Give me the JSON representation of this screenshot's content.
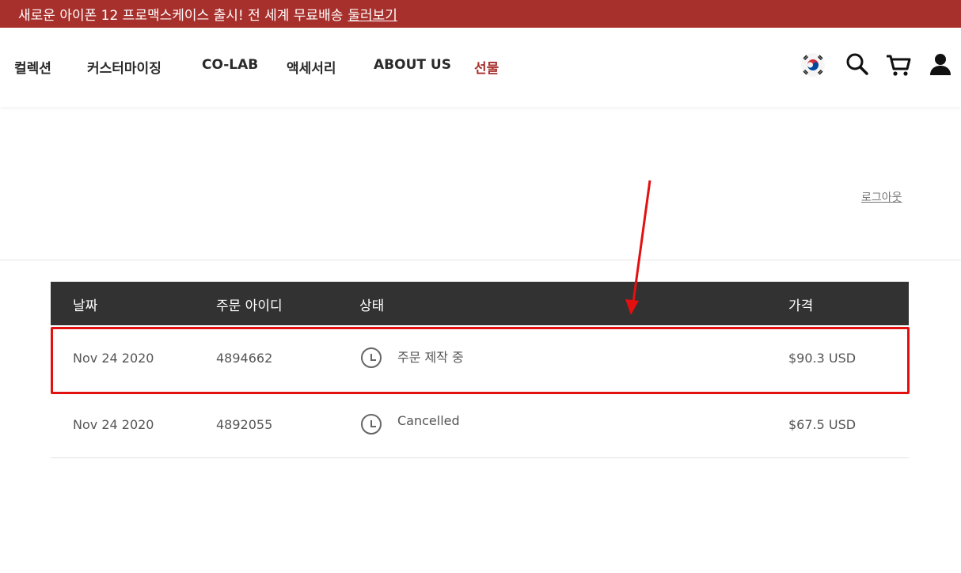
{
  "promo": {
    "text": "새로운 아이폰 12 프로맥스케이스 출시! 전 세계 무료배송",
    "link": "둘러보기"
  },
  "nav": {
    "items": [
      "컬렉션",
      "커스터마이징",
      "CO-LAB",
      "액세서리",
      "ABOUT US",
      "선물"
    ],
    "active_index": 5,
    "icons": [
      "korea-flag-icon",
      "search-icon",
      "cart-icon",
      "user-icon"
    ]
  },
  "account": {
    "logout": "로그아웃"
  },
  "orders": {
    "headers": {
      "date": "날짜",
      "order_id": "주문 아이디",
      "status": "상태",
      "price": "가격"
    },
    "rows": [
      {
        "date": "Nov 24 2020",
        "order_id": "4894662",
        "status": "주문 제작 중",
        "price": "$90.3 USD"
      },
      {
        "date": "Nov 24 2020",
        "order_id": "4892055",
        "status": "Cancelled",
        "price": "$67.5 USD"
      }
    ]
  },
  "colors": {
    "brand": "#a8302c",
    "header_bg": "#323232",
    "annotation": "#e31010"
  }
}
